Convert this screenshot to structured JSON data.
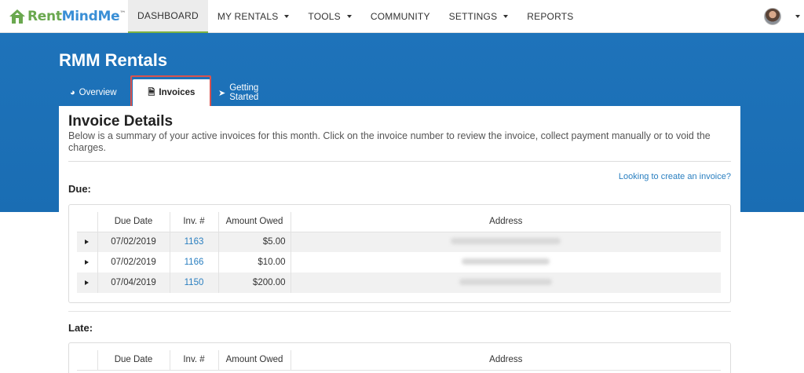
{
  "brand": {
    "logo_rent": "Rent",
    "logo_mind": "MindMe",
    "logo_tm": "™"
  },
  "nav": [
    {
      "label": "DASHBOARD",
      "active": true,
      "dropdown": false
    },
    {
      "label": "MY RENTALS",
      "active": false,
      "dropdown": true
    },
    {
      "label": "TOOLS",
      "active": false,
      "dropdown": true
    },
    {
      "label": "COMMUNITY",
      "active": false,
      "dropdown": false
    },
    {
      "label": "SETTINGS",
      "active": false,
      "dropdown": true
    },
    {
      "label": "REPORTS",
      "active": false,
      "dropdown": false
    }
  ],
  "page": {
    "title": "RMM Rentals"
  },
  "tabs": {
    "overview": "Overview",
    "invoices": "Invoices",
    "getting_started": "Getting Started"
  },
  "section": {
    "title": "Invoice Details",
    "description": "Below is a summary of your active invoices for this month. Click on the invoice number to review the invoice, collect payment manually or to void the charges.",
    "create_link": "Looking to create an invoice?",
    "due_label": "Due:",
    "late_label": "Late:"
  },
  "table_headers": {
    "due_date": "Due Date",
    "inv": "Inv. #",
    "amount": "Amount Owed",
    "address": "Address"
  },
  "due_rows": [
    {
      "date": "07/02/2019",
      "inv": "1163",
      "amount": "$5.00"
    },
    {
      "date": "07/02/2019",
      "inv": "1166",
      "amount": "$10.00"
    },
    {
      "date": "07/04/2019",
      "inv": "1150",
      "amount": "$200.00"
    }
  ],
  "colors": {
    "banner": "#1e73ba",
    "accent_green": "#7cb342",
    "link": "#2a7fc0",
    "highlight": "#d9534f"
  }
}
